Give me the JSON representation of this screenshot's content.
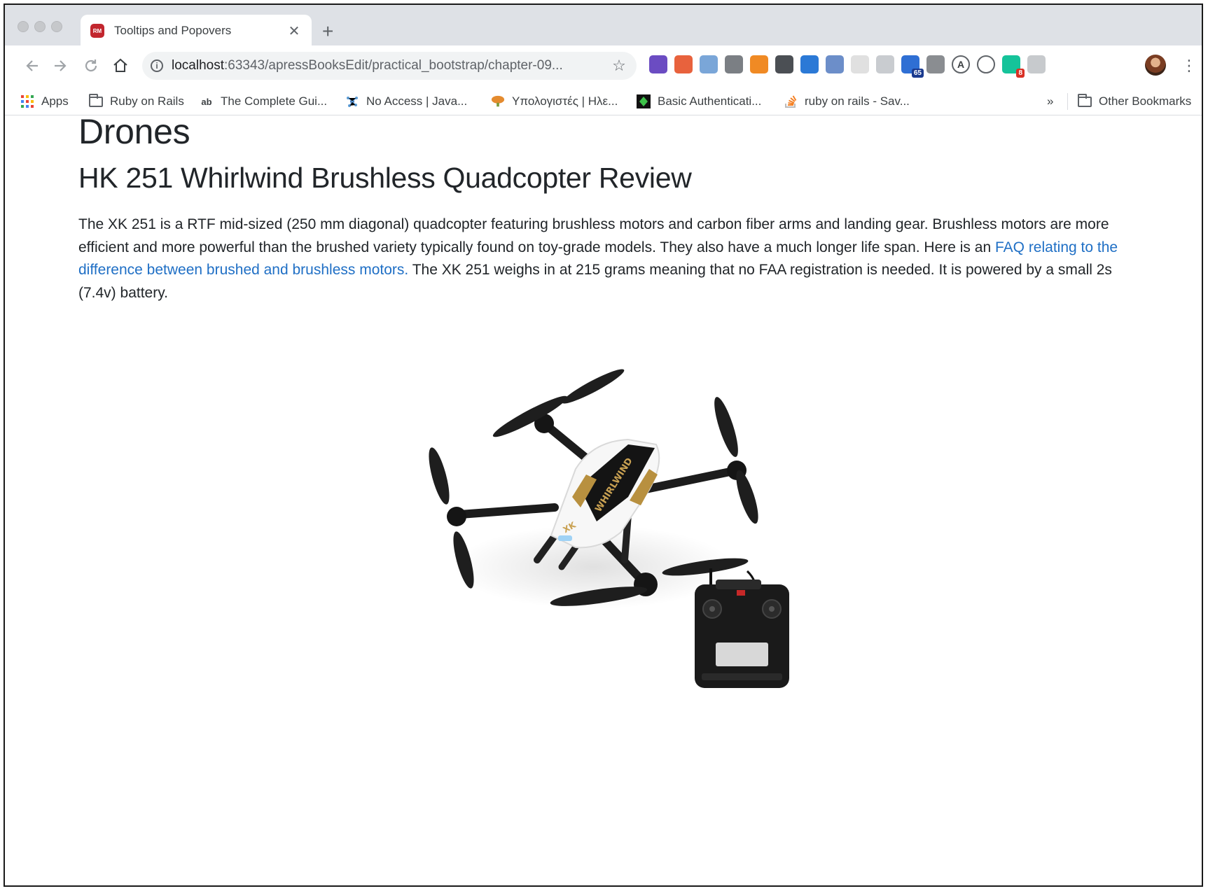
{
  "browser": {
    "tab": {
      "title": "Tooltips and Popovers",
      "favicon_text": "RM"
    },
    "url": {
      "host": "localhost",
      "rest": ":63343/apressBooksEdit/practical_bootstrap/chapter-09..."
    },
    "extensions": [
      {
        "name": "eyedropper-extension",
        "color": "#6b4cc2"
      },
      {
        "name": "sitemap-extension",
        "color": "#e8623d"
      },
      {
        "name": "info-extension",
        "color": "#7aa6d8"
      },
      {
        "name": "c-extension",
        "color": "#7b7f84"
      },
      {
        "name": "orange-extension",
        "color": "#f08a24"
      },
      {
        "name": "bulb-extension",
        "color": "#4b4f54"
      },
      {
        "name": "download-extension",
        "color": "#2b79d6"
      },
      {
        "name": "screenshot-extension",
        "color": "#6c8ec9"
      },
      {
        "name": "grid-extension",
        "color": "#e0e0e0"
      },
      {
        "name": "chat-extension",
        "color": "#c9ccd0"
      },
      {
        "name": "page-extension",
        "color": "#2f6fd4",
        "badge": "65"
      },
      {
        "name": "globe-extension",
        "color": "#8a8d91"
      },
      {
        "name": "a-extension",
        "color": "#ffffff",
        "glyph": "A"
      },
      {
        "name": "move-extension",
        "color": "#ffffff"
      },
      {
        "name": "grammarly-extension",
        "color": "#15c39a",
        "badge": "8"
      },
      {
        "name": "cards-extension",
        "color": "#c7cacd"
      }
    ]
  },
  "bookmarks": {
    "apps": "Apps",
    "items": [
      {
        "label": "Ruby on Rails"
      },
      {
        "label": "The Complete Gui..."
      },
      {
        "label": "No Access | Java..."
      },
      {
        "label": "Υπολογιστές | Ηλε..."
      },
      {
        "label": "Basic Authenticati..."
      },
      {
        "label": "ruby on rails - Sav..."
      }
    ],
    "overflow": "»",
    "other": "Other Bookmarks"
  },
  "page": {
    "h1": "Drones",
    "h2": "HK 251 Whirlwind Brushless Quadcopter Review",
    "para_1": "The XK 251 is a RTF mid-sized (250 mm diagonal) quadcopter featuring brushless motors and carbon fiber arms and landing gear. Brushless motors are more efficient and more powerful than the brushed variety typically found on toy-grade models. They also have a much longer life span. Here is an ",
    "link": "FAQ relating to the difference between brushed and brushless motors.",
    "para_2": " The XK 251 weighs in at 215 grams meaning that no FAA registration is needed. It is powered by a small 2s (7.4v) battery.",
    "drone_label": "WHIRLWIND",
    "drone_mark": "XK"
  }
}
